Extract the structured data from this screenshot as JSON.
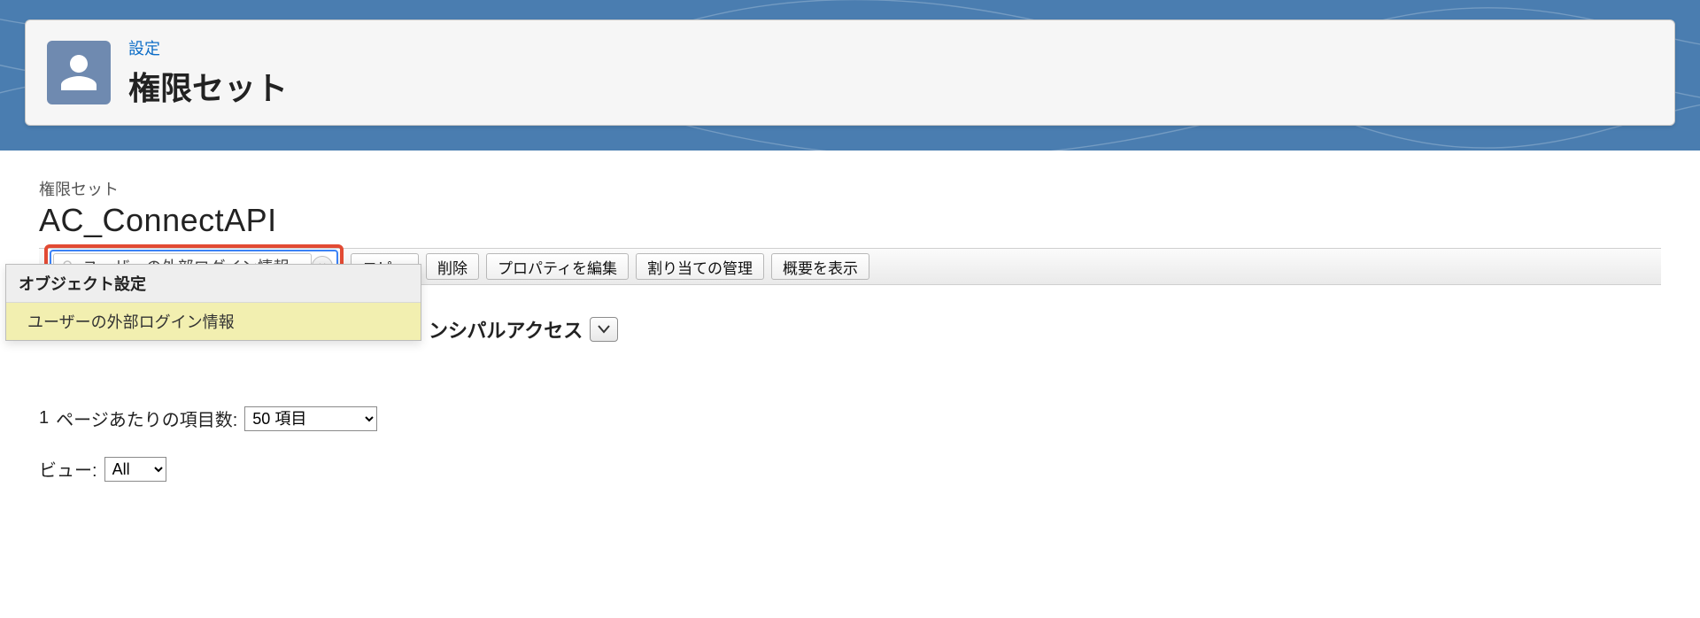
{
  "header": {
    "eyebrow": "設定",
    "title": "権限セット"
  },
  "section": {
    "label": "権限セット",
    "title": "AC_ConnectAPI"
  },
  "toolbar": {
    "search_value": "ユーザーの外部ログイン情報",
    "buttons": {
      "copy": "コピー",
      "delete": "削除",
      "edit_props": "プロパティを編集",
      "manage_assign": "割り当ての管理",
      "show_summary": "概要を表示"
    }
  },
  "suggest": {
    "group": "オブジェクト設定",
    "item0": "ユーザーの外部ログイン情報"
  },
  "mid": {
    "visible_fragment": "ンシパルアクセス"
  },
  "pager": {
    "count_prefix": "1",
    "label": "ページあたりの項目数:",
    "selected": "50 項目"
  },
  "view": {
    "label": "ビュー:",
    "selected": "All"
  }
}
